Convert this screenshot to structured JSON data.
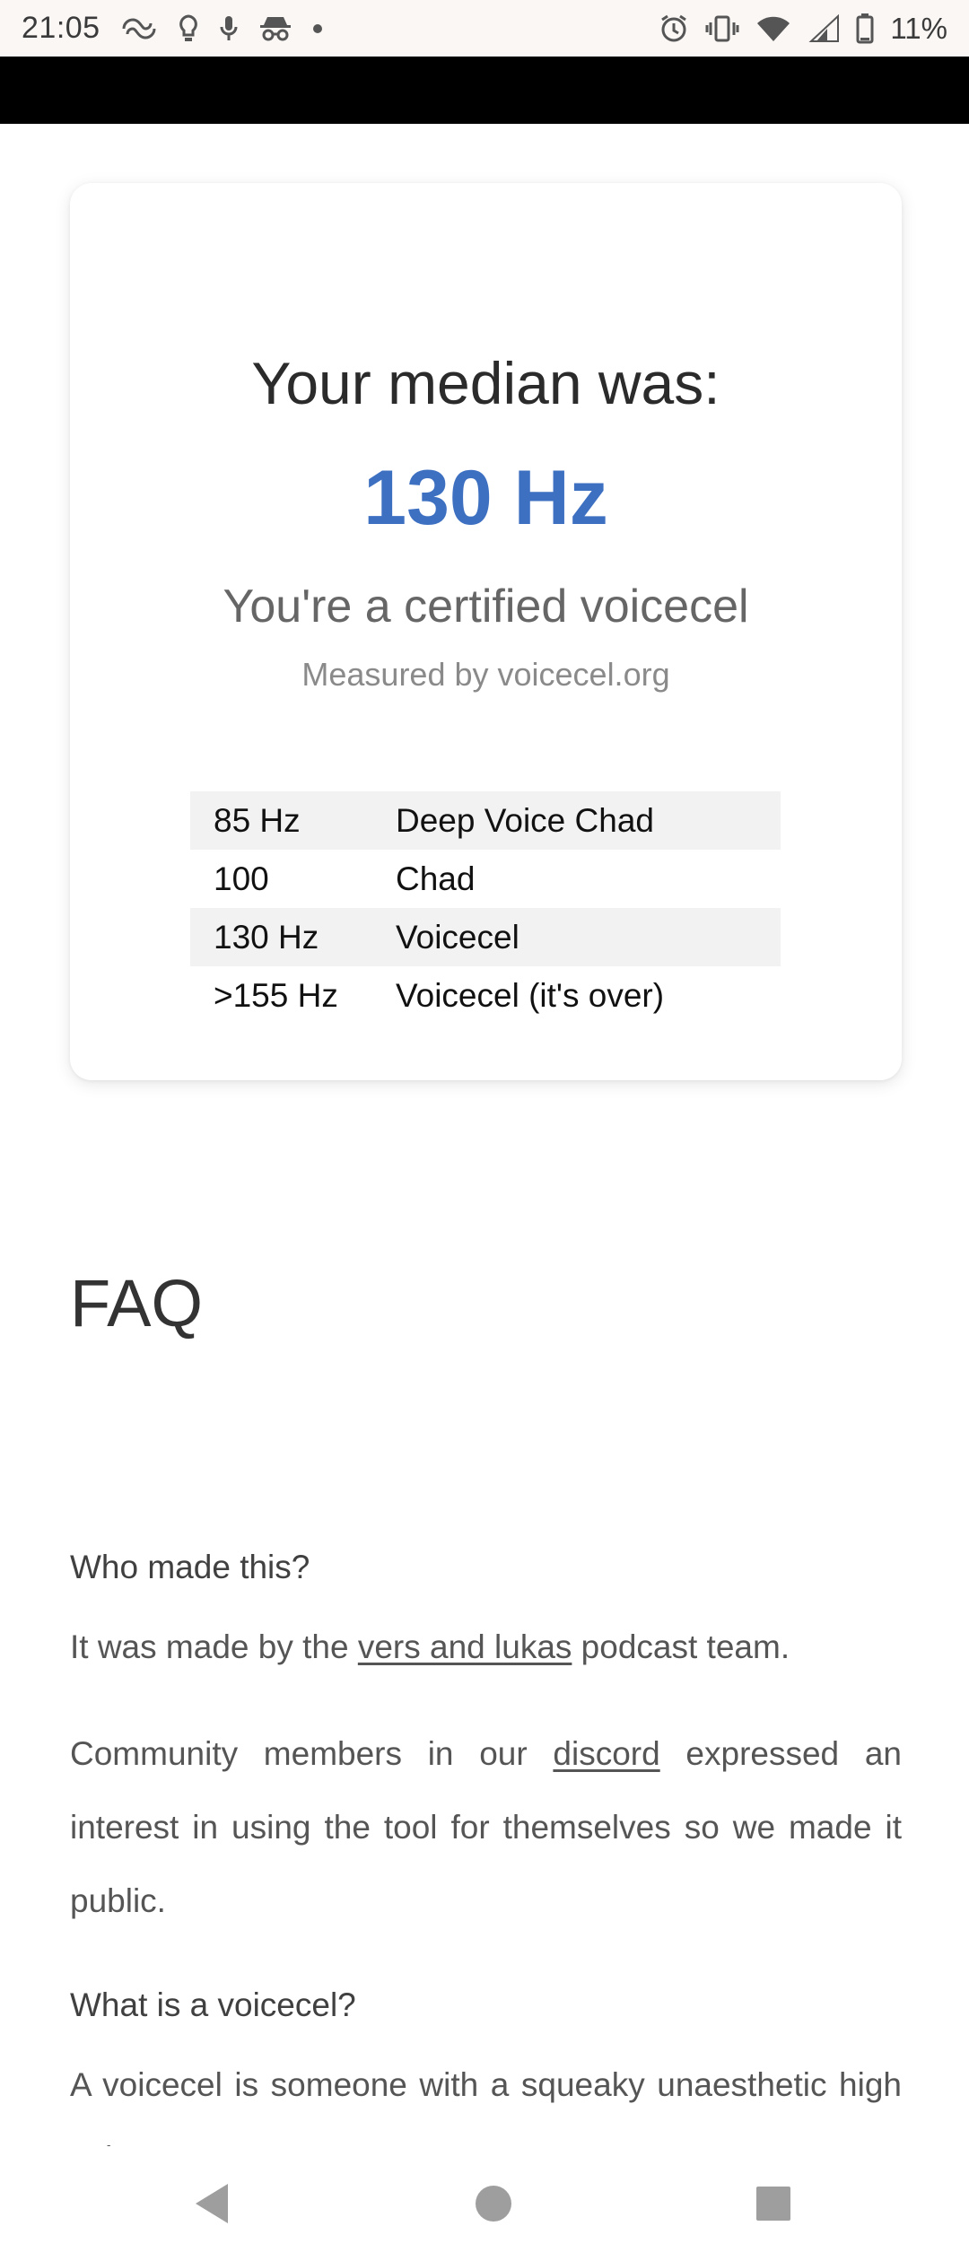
{
  "status_bar": {
    "time": "21:05",
    "battery": "11%",
    "left_icons": [
      "infinity-icon",
      "lightbulb-icon",
      "microphone-icon",
      "incognito-icon",
      "dot-icon"
    ],
    "right_icons": [
      "alarm-icon",
      "vibrate-icon",
      "wifi-icon",
      "signal-icon",
      "battery-icon"
    ]
  },
  "result": {
    "heading": "Your median was:",
    "value": "130 Hz",
    "verdict": "You're a certified voicecel",
    "credit": "Measured by voicecel.org",
    "accent_color": "#3e70c2"
  },
  "scale_table": {
    "rows": [
      {
        "frequency": "85 Hz",
        "label": "Deep Voice Chad"
      },
      {
        "frequency": "100",
        "label": "Chad"
      },
      {
        "frequency": "130 Hz",
        "label": "Voicecel"
      },
      {
        "frequency": ">155 Hz",
        "label": "Voicecel (it's over)"
      }
    ]
  },
  "faq": {
    "title": "FAQ",
    "q1": {
      "question": "Who made this?",
      "answer1_before": "It was made by the ",
      "answer1_link": "vers and lukas",
      "answer1_after": " podcast team.",
      "answer2_before": "Community members in our ",
      "answer2_link": "discord",
      "answer2_after": " expressed an interest in using the tool for themselves so we made it public."
    },
    "q2": {
      "question": "What is a voicecel?",
      "answer": "A voicecel is someone with a squeaky unaesthetic high voice."
    }
  },
  "nav_bar": {
    "buttons": [
      "back-icon",
      "home-icon",
      "recents-icon"
    ]
  }
}
